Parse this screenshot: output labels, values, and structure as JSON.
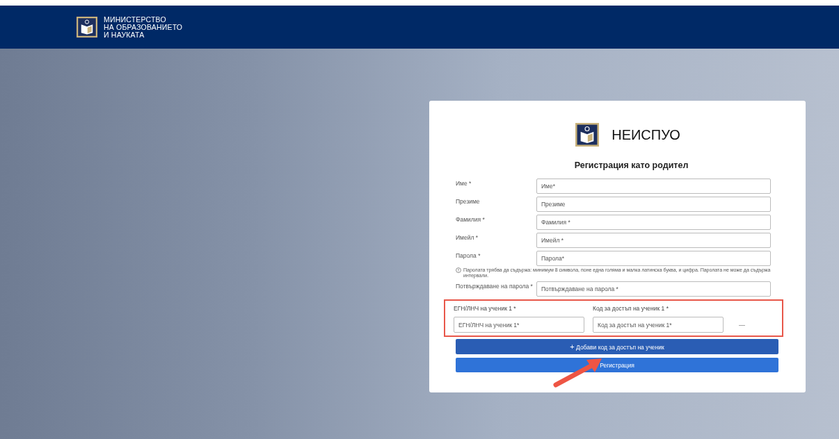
{
  "header": {
    "ministry_name": [
      "МИНИСТЕРСТВО",
      "НА ОБРАЗОВАНИЕТО",
      "И НАУКАТА"
    ]
  },
  "card": {
    "brand": "НЕИСПУО",
    "title": "Регистрация като родител",
    "fields": [
      {
        "label": "Име *",
        "placeholder": "Име*"
      },
      {
        "label": "Презиме",
        "placeholder": "Презиме"
      },
      {
        "label": "Фамилия *",
        "placeholder": "Фамилия *"
      },
      {
        "label": "Имейл *",
        "placeholder": "Имейл *"
      },
      {
        "label": "Парола *",
        "placeholder": "Парола*",
        "hint": "Паролата трябва да съдържа: минимум 8 символа, поне една голяма и малка латинска буква, и цифра. Паролата не може да съдържа интервали."
      },
      {
        "label": "Потвърждаване на парола *",
        "placeholder": "Потвърждаване на парола *"
      }
    ],
    "students": [
      {
        "id_label": "ЕГН/ЛНЧ на ученик 1 *",
        "id_placeholder": "ЕГН/ЛНЧ на ученик 1*",
        "code_label": "Код за достъп на ученик 1 *",
        "code_placeholder": "Код за достъп на ученик 1*",
        "remove": "—"
      }
    ],
    "add_button": {
      "icon": "+",
      "label": "Добави код за достъп на ученик"
    },
    "submit_button": "Регистрация"
  }
}
